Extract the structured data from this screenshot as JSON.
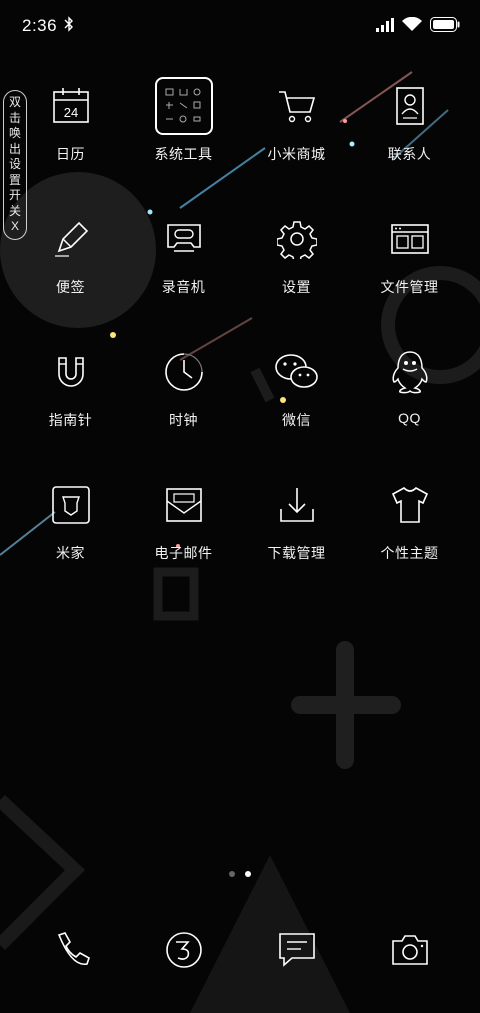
{
  "status_bar": {
    "time": "2:36",
    "battery_icon": "battery-icon",
    "signal_icon": "cell-signal-icon",
    "wifi_icon": "wifi-icon",
    "bluetooth_icon": "bluetooth-icon"
  },
  "side_toggle": {
    "chars": [
      "双",
      "击",
      "唤",
      "出",
      "设",
      "置",
      "开",
      "关",
      "X"
    ]
  },
  "apps": [
    {
      "label": "日历",
      "icon": "calendar-icon",
      "badge": "24"
    },
    {
      "label": "系统工具",
      "icon": "tools-folder-icon"
    },
    {
      "label": "小米商城",
      "icon": "shopping-cart-icon"
    },
    {
      "label": "联系人",
      "icon": "contacts-icon"
    },
    {
      "label": "便签",
      "icon": "pencil-icon"
    },
    {
      "label": "录音机",
      "icon": "recorder-icon"
    },
    {
      "label": "设置",
      "icon": "gear-icon"
    },
    {
      "label": "文件管理",
      "icon": "file-manager-icon"
    },
    {
      "label": "指南针",
      "icon": "magnet-compass-icon"
    },
    {
      "label": "时钟",
      "icon": "clock-icon"
    },
    {
      "label": "微信",
      "icon": "wechat-icon"
    },
    {
      "label": "QQ",
      "icon": "qq-penguin-icon"
    },
    {
      "label": "米家",
      "icon": "mijia-icon"
    },
    {
      "label": "电子邮件",
      "icon": "mail-icon"
    },
    {
      "label": "下载管理",
      "icon": "download-icon"
    },
    {
      "label": "个性主题",
      "icon": "tshirt-icon"
    }
  ],
  "page_indicator": {
    "pages": 2,
    "active": 2
  },
  "dock": [
    {
      "icon": "phone-icon"
    },
    {
      "icon": "browser-icon"
    },
    {
      "icon": "message-icon"
    },
    {
      "icon": "camera-icon"
    }
  ],
  "colors": {
    "background": "#050505",
    "foreground": "#ffffff",
    "shape": "#2a2a2a"
  }
}
